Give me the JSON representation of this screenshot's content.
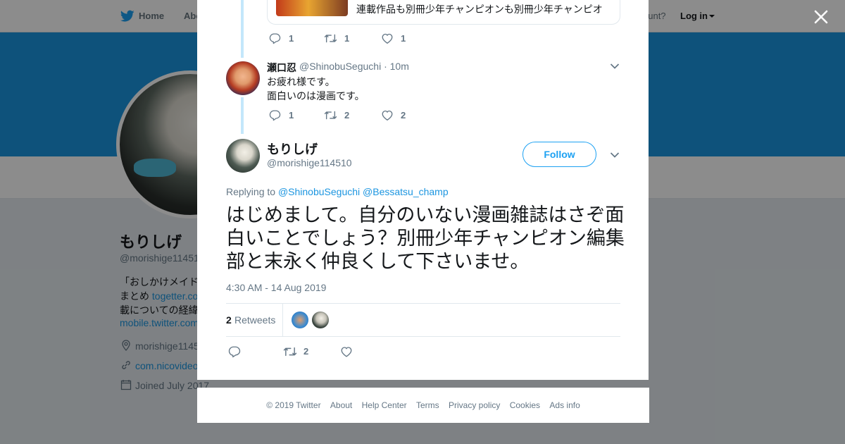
{
  "nav": {
    "home": "Home",
    "about": "Abo",
    "account_prompt": "ccount?",
    "login": "Log in"
  },
  "profile_bg": {
    "name": "もりしげ",
    "handle": "@morishige11451",
    "bio_line1": "「おしかけメイド",
    "bio_line2_prefix": "まとめ ",
    "bio_line2_link": "togetter.co",
    "bio_line3": "載についての経緯",
    "bio_line4": "mobile.twitter.com",
    "location": "morishige1145",
    "url": "com.nicovideo",
    "joined": "Joined July 2017"
  },
  "thread": {
    "prev_tweet": {
      "quoted_text": "連載作品も別冊少年チャンピオンも別冊少年チャンピオ",
      "replies": "1",
      "retweets": "1",
      "likes": "1"
    },
    "reply_tweet": {
      "name": "瀬口忍",
      "handle_time": "@ShinobuSeguchi · 10m",
      "line1": "お疲れ様です。",
      "line2": "面白いのは漫画です。",
      "replies": "1",
      "retweets": "2",
      "likes": "2"
    }
  },
  "main_tweet": {
    "name": "もりしげ",
    "handle": "@morishige114510",
    "follow_label": "Follow",
    "replying_prefix": "Replying to ",
    "replying_to_1": "@ShinobuSeguchi",
    "replying_to_2": "@Bessatsu_champ",
    "text": "はじめまして。自分のいない漫画雑誌はさぞ面白いことでしょう？別冊少年チャンピオン編集部と末永く仲良くして下さいませ。",
    "time": "4:30 AM - 14 Aug 2019",
    "retweet_count": "2",
    "retweet_label": "Retweets",
    "action_retweets": "2"
  },
  "footer": {
    "copyright": "© 2019 Twitter",
    "about": "About",
    "help": "Help Center",
    "terms": "Terms",
    "privacy": "Privacy policy",
    "cookies": "Cookies",
    "ads": "Ads info"
  },
  "colors": {
    "brand": "#1da1f2",
    "banner": "#1b95e0",
    "muted": "#657786",
    "thread_line": "#c4e7fb"
  },
  "icons": {
    "logo": "twitter-bird-icon",
    "close": "close-icon",
    "reply": "reply-icon",
    "retweet": "retweet-icon",
    "like": "heart-icon",
    "more": "chevron-down-icon"
  }
}
